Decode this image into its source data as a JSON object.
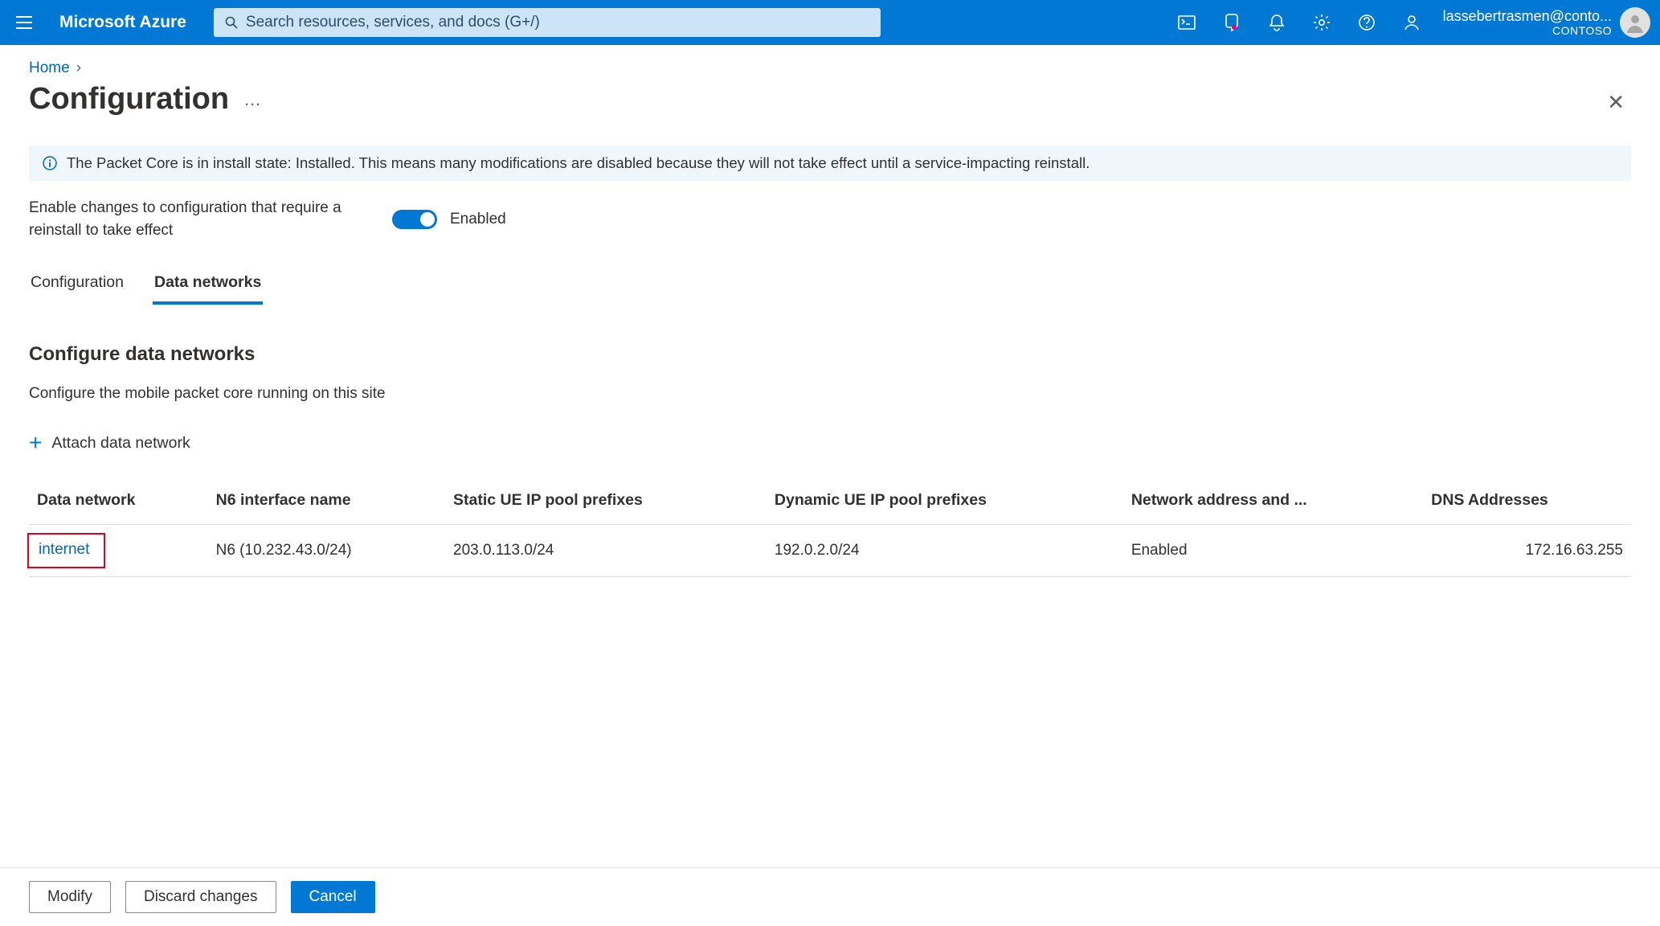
{
  "header": {
    "brand": "Microsoft Azure",
    "search_placeholder": "Search resources, services, and docs (G+/)",
    "account_email": "lassebertrasmen@conto...",
    "tenant": "CONTOSO"
  },
  "breadcrumb": {
    "home": "Home"
  },
  "title": "Configuration",
  "banner": {
    "text": "The Packet Core is in install state: Installed. This means many modifications are disabled because they will not take effect until a service-impacting reinstall."
  },
  "toggle": {
    "label": "Enable changes to configuration that require a reinstall to take effect",
    "state_label": "Enabled"
  },
  "tabs": {
    "configuration": "Configuration",
    "data_networks": "Data networks"
  },
  "section": {
    "title": "Configure data networks",
    "desc": "Configure the mobile packet core running on this site"
  },
  "attach_label": "Attach data network",
  "table": {
    "columns": {
      "data_network": "Data network",
      "n6": "N6 interface name",
      "static_ue": "Static UE IP pool prefixes",
      "dynamic_ue": "Dynamic UE IP pool prefixes",
      "napt": "Network address and ...",
      "dns": "DNS Addresses"
    },
    "rows": [
      {
        "data_network": "internet",
        "n6": "N6 (10.232.43.0/24)",
        "static_ue": "203.0.113.0/24",
        "dynamic_ue": "192.0.2.0/24",
        "napt": "Enabled",
        "dns": "172.16.63.255"
      }
    ]
  },
  "footer": {
    "modify": "Modify",
    "discard": "Discard changes",
    "cancel": "Cancel"
  }
}
